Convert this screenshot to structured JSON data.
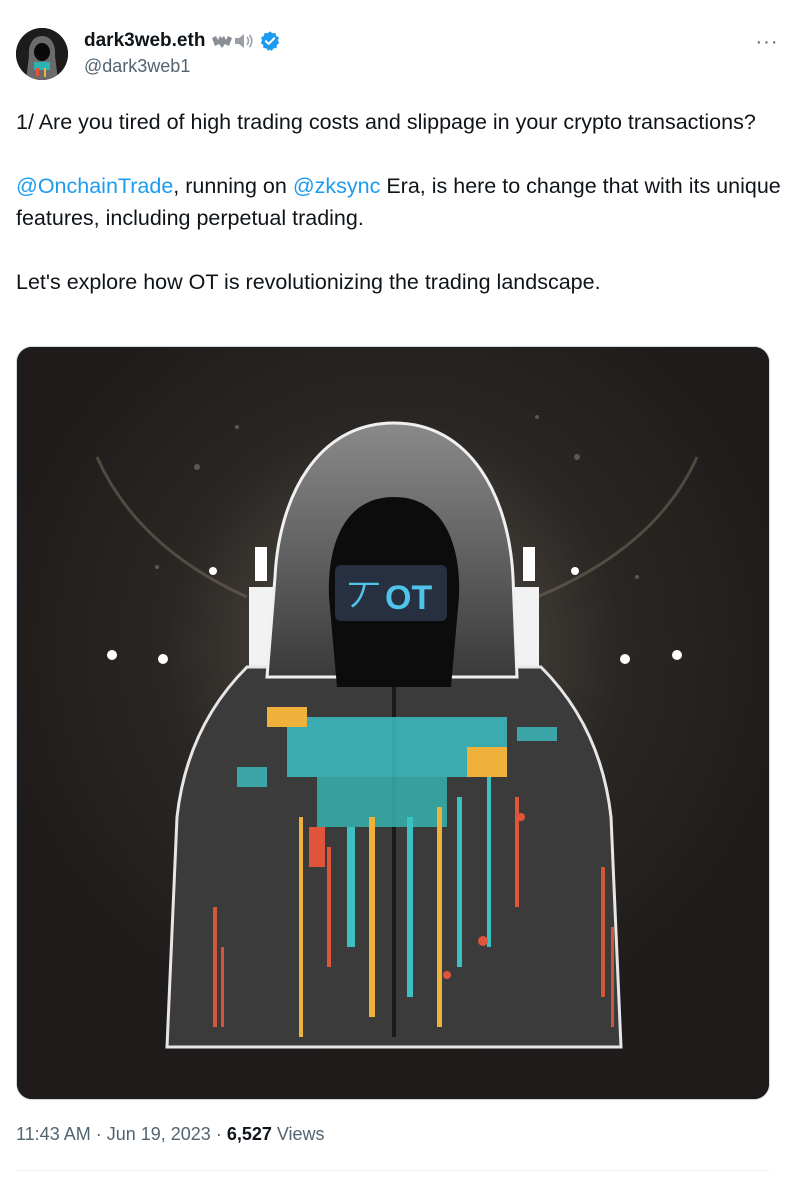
{
  "author": {
    "display_name": "dark3web.eth",
    "handle": "@dark3web1",
    "avatar_icon": "hooded-figure-avatar",
    "emoji_icons": [
      "bat-icon",
      "speaker-icon"
    ],
    "verified": true,
    "verified_color": "#1d9bf0"
  },
  "more_icon": "···",
  "tweet": {
    "line1": "1/ Are you tired of high trading costs and slippage in your crypto transactions?",
    "mention1": "@OnchainTrade",
    "seg1": ", running on ",
    "mention2": "@zksync",
    "seg2": " Era, is here to change that with its unique features, including perpetual trading.",
    "line3": "Let's explore how OT is revolutionizing the trading landscape."
  },
  "media": {
    "logo_text": "OT",
    "logo_glyph": "丆",
    "accent": "#3cc0c4"
  },
  "meta": {
    "time": "11:43 AM",
    "sep1": " · ",
    "date": "Jun 19, 2023",
    "sep2": " · ",
    "views_count": "6,527",
    "views_label": " Views"
  },
  "colors": {
    "text": "#0f1419",
    "secondary": "#536471",
    "link": "#1d9bf0"
  }
}
